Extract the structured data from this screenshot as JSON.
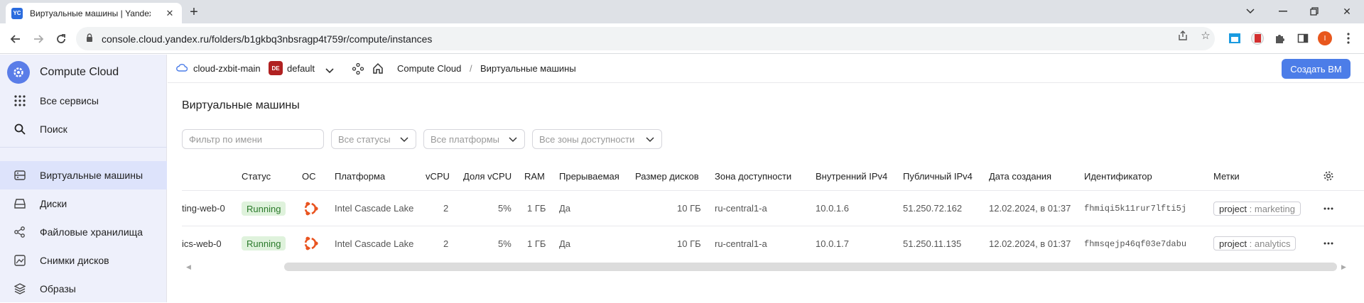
{
  "browser": {
    "tab_title": "Виртуальные машины | Yandex",
    "tab_favicon": "YC",
    "url": "console.cloud.yandex.ru/folders/b1gkbq3nbsragp4t759r/compute/instances",
    "profile_initial": "I"
  },
  "sidebar": {
    "brand": "Compute Cloud",
    "items": [
      {
        "label": "Все сервисы",
        "icon": "grid-icon"
      },
      {
        "label": "Поиск",
        "icon": "search-icon"
      },
      {
        "label": "Виртуальные машины",
        "icon": "vm-icon",
        "active": true
      },
      {
        "label": "Диски",
        "icon": "disk-icon"
      },
      {
        "label": "Файловые хранилища",
        "icon": "share-icon"
      },
      {
        "label": "Снимки дисков",
        "icon": "snapshot-icon"
      },
      {
        "label": "Образы",
        "icon": "image-icon"
      }
    ]
  },
  "header": {
    "cloud": "cloud-zxbit-main",
    "folder_badge": "DE",
    "folder": "default",
    "breadcrumb_service": "Compute Cloud",
    "breadcrumb_separator": "/",
    "breadcrumb_current": "Виртуальные машины",
    "create_button": "Создать ВМ"
  },
  "main": {
    "title": "Виртуальные машины",
    "filters": {
      "name_placeholder": "Фильтр по имени",
      "status": "Все статусы",
      "platform": "Все платформы",
      "zone": "Все зоны доступности"
    },
    "columns": [
      "Статус",
      "ОС",
      "Платформа",
      "vCPU",
      "Доля vCPU",
      "RAM",
      "Прерываемая",
      "Размер дисков",
      "Зона доступности",
      "Внутренний IPv4",
      "Публичный IPv4",
      "Дата создания",
      "Идентификатор",
      "Метки"
    ],
    "rows": [
      {
        "name": "ting-web-0",
        "status": "Running",
        "os": "ubuntu-icon",
        "platform": "Intel Cascade Lake",
        "vcpu": "2",
        "vcpu_share": "5%",
        "ram": "1 ГБ",
        "preemptible": "Да",
        "disk_size": "10 ГБ",
        "zone": "ru-central1-a",
        "internal_ip": "10.0.1.6",
        "public_ip": "51.250.72.162",
        "created": "12.02.2024, в 01:37",
        "id": "fhmiqi5k11rur7lfti5j",
        "label_key": "project",
        "label_sep": " : ",
        "label_value": "marketing"
      },
      {
        "name": "ics-web-0",
        "status": "Running",
        "os": "ubuntu-icon",
        "platform": "Intel Cascade Lake",
        "vcpu": "2",
        "vcpu_share": "5%",
        "ram": "1 ГБ",
        "preemptible": "Да",
        "disk_size": "10 ГБ",
        "zone": "ru-central1-a",
        "internal_ip": "10.0.1.7",
        "public_ip": "51.250.11.135",
        "created": "12.02.2024, в 01:37",
        "id": "fhmsqejp46qf03e7dabu",
        "label_key": "project",
        "label_sep": " : ",
        "label_value": "analytics"
      }
    ]
  },
  "colors": {
    "accent": "#4c7de8",
    "sidebar_bg": "#eef0fb",
    "running_bg": "#dff2dc",
    "running_text": "#2a7a2a",
    "ubuntu": "#e95420"
  }
}
